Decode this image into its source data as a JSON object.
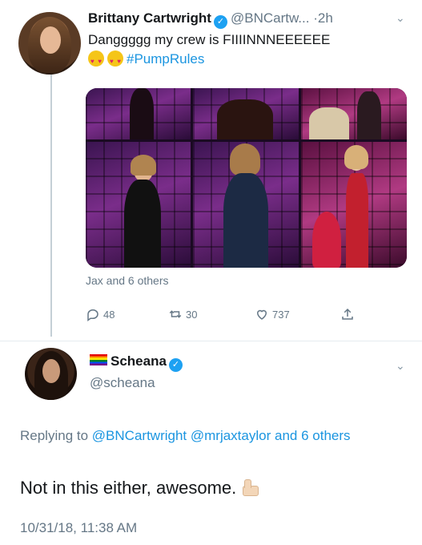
{
  "tweet": {
    "name": "Brittany Cartwright",
    "handle": "@BNCartw...",
    "separator": "·",
    "time": "2h",
    "text": "Danggggg my crew is FIIIINNNEEEEEE",
    "hashtag": "#PumpRules",
    "emoji": "heart-eyes-emoji",
    "liked_by": "Jax and 6 others",
    "replies": "48",
    "retweets": "30",
    "likes": "737"
  },
  "reply": {
    "name": "Scheana",
    "handle": "@scheana",
    "replying_prefix": "Replying to",
    "mentions": [
      "@BNCartwright",
      "@mrjaxtaylor"
    ],
    "replying_suffix": "and 6 others",
    "text": "Not in this either, awesome.",
    "timestamp": "10/31/18, 11:38 AM"
  },
  "icons": {
    "verified": "verified-badge-icon",
    "reply": "reply-icon",
    "retweet": "retweet-icon",
    "like": "heart-icon",
    "share": "share-icon",
    "menu": "chevron-down-icon"
  },
  "colors": {
    "link": "#1b95e0",
    "verified": "#1da1f2",
    "muted": "#657786"
  }
}
